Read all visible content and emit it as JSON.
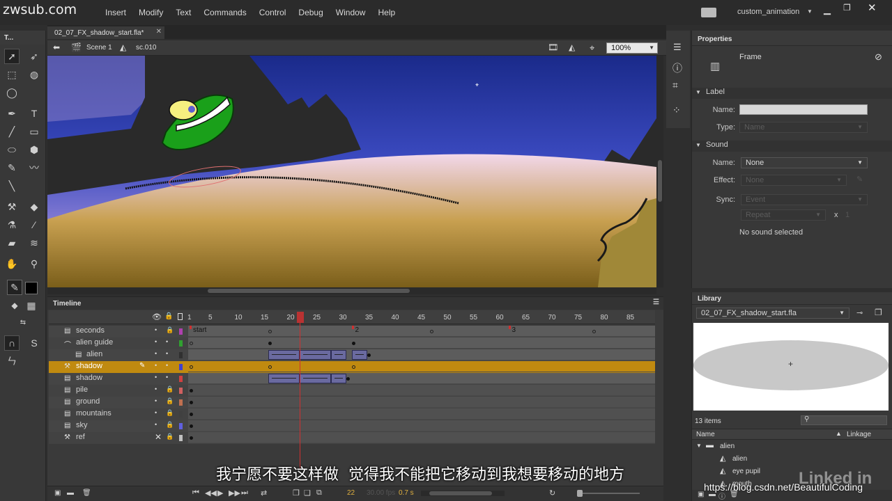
{
  "watermark_top": "zwsub.com",
  "menu": [
    "Insert",
    "Modify",
    "Text",
    "Commands",
    "Control",
    "Debug",
    "Window",
    "Help"
  ],
  "workspace": "custom_animation",
  "document_tab": "02_07_FX_shadow_start.fla*",
  "tools_label": "T...",
  "edit_bar": {
    "scene": "Scene 1",
    "symbol": "sc.010",
    "zoom": "100%"
  },
  "properties": {
    "title": "Properties",
    "frame_label": "Frame",
    "label_section": "Label",
    "name_label": "Name:",
    "type_label": "Type:",
    "type_value": "Name",
    "sound_section": "Sound",
    "sound_name_label": "Name:",
    "sound_name_value": "None",
    "effect_label": "Effect:",
    "effect_value": "None",
    "sync_label": "Sync:",
    "sync_value": "Event",
    "repeat_value": "Repeat",
    "repeat_x": "x",
    "repeat_count": "1",
    "no_sound": "No sound selected"
  },
  "library": {
    "title": "Library",
    "file": "02_07_FX_shadow_start.fla",
    "item_count": "13 items",
    "col_name": "Name",
    "col_linkage": "Linkage",
    "items": [
      {
        "name": "alien",
        "kind": "folder"
      },
      {
        "name": "alien",
        "kind": "symbol"
      },
      {
        "name": "eye pupil",
        "kind": "symbol"
      },
      {
        "name": "mouth",
        "kind": "symbol"
      }
    ]
  },
  "timeline": {
    "title": "Timeline",
    "ruler": [
      "1",
      "5",
      "10",
      "15",
      "20",
      "25",
      "30",
      "35",
      "40",
      "45",
      "50",
      "55",
      "60",
      "65",
      "70",
      "75",
      "80",
      "85"
    ],
    "labels": [
      "start",
      "2",
      "3"
    ],
    "current_frame": "22",
    "fps": "30.00 fps",
    "elapsed": "0.7 s",
    "layers": [
      {
        "name": "seconds",
        "locked": true,
        "color": "#b040b0",
        "selected": false
      },
      {
        "name": "alien guide",
        "locked": false,
        "color": "#30a030",
        "selected": false
      },
      {
        "name": "alien",
        "locked": false,
        "color": "#303030",
        "selected": false
      },
      {
        "name": "shadow",
        "locked": false,
        "color": "#4040d0",
        "selected": true
      },
      {
        "name": "shadow",
        "locked": false,
        "color": "#d04040",
        "selected": false
      },
      {
        "name": "pile",
        "locked": true,
        "color": "#d06060",
        "selected": false
      },
      {
        "name": "ground",
        "locked": true,
        "color": "#c07050",
        "selected": false
      },
      {
        "name": "mountains",
        "locked": true,
        "color": "#404040",
        "selected": false
      },
      {
        "name": "sky",
        "locked": true,
        "color": "#6060e0",
        "selected": false
      },
      {
        "name": "ref",
        "locked": true,
        "color": "#c0c0c0",
        "selected": false
      }
    ]
  },
  "subtitle": "我宁愿不要这样做  觉得我不能把它移动到我想要移动的地方",
  "watermark_bottom": "https://blog.csdn.net/BeautifulCoding",
  "linkedin": "Linked in"
}
